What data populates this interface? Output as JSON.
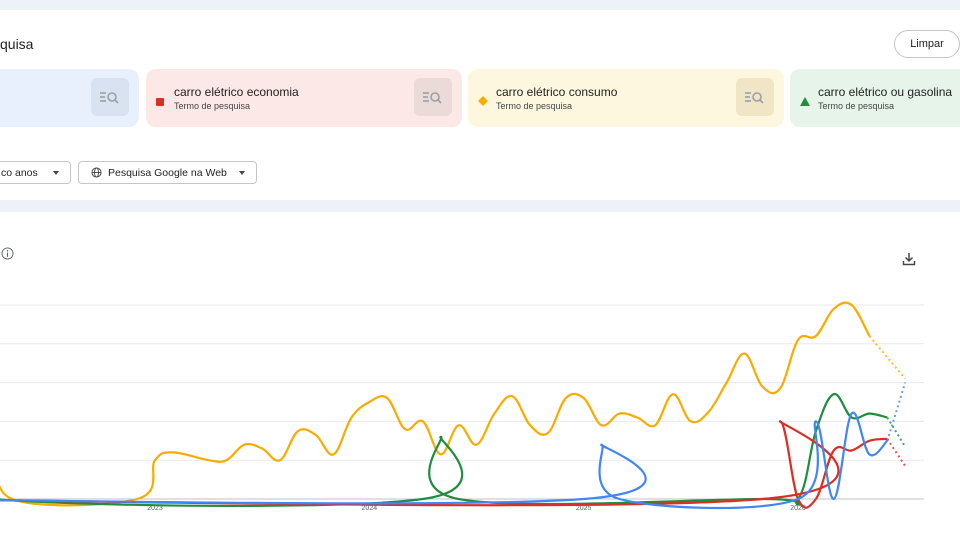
{
  "header": {
    "title": "quisa",
    "clear_label": "Limpar"
  },
  "terms": [
    {
      "label": "",
      "sub": "",
      "color": "#4285f4",
      "bg": "#e8f0fe"
    },
    {
      "label": "carro elétrico economia",
      "sub": "Termo de pesquisa",
      "color": "#d93025",
      "bg": "#fce8e6",
      "shape": "square"
    },
    {
      "label": "carro elétrico consumo",
      "sub": "Termo de pesquisa",
      "color": "#f9ab00",
      "bg": "#fef7e0",
      "shape": "diamond"
    },
    {
      "label": "carro elétrico ou gasolina",
      "sub": "Termo de pesquisa",
      "color": "#1e8e3e",
      "bg": "#e6f4ea",
      "shape": "triangle"
    }
  ],
  "filters": {
    "period": "co anos",
    "source": "Pesquisa Google na Web"
  },
  "icons": {
    "search_term": "search-term-icon",
    "info": "info-icon",
    "download": "download-icon",
    "globe": "globe-icon",
    "dropdown": "chevron-down-icon"
  },
  "chart_data": {
    "type": "line",
    "x_ticks": [
      "2023",
      "2024",
      "2025",
      "2026"
    ],
    "x_range": [
      "2021-09",
      "2026-07"
    ],
    "y_range": [
      0,
      100
    ],
    "grid": true,
    "legend": "none",
    "series": [
      {
        "name": "carro elétrico consumo",
        "color": "#f9ab00",
        "points": [
          [
            "2021-09",
            40
          ],
          [
            "2021-11",
            40
          ],
          [
            "2022-01",
            38
          ],
          [
            "2022-02",
            35
          ],
          [
            "2022-03",
            0
          ],
          [
            "2022-04",
            28
          ],
          [
            "2022-05",
            0
          ],
          [
            "2022-12",
            0
          ],
          [
            "2023-01",
            20
          ],
          [
            "2023-02",
            24
          ],
          [
            "2023-04",
            20
          ],
          [
            "2023-05",
            20
          ],
          [
            "2023-06",
            28
          ],
          [
            "2023-07",
            26
          ],
          [
            "2023-08",
            20
          ],
          [
            "2023-09",
            35
          ],
          [
            "2023-10",
            33
          ],
          [
            "2023-11",
            23
          ],
          [
            "2023-12",
            42
          ],
          [
            "2024-01",
            50
          ],
          [
            "2024-02",
            52
          ],
          [
            "2024-03",
            36
          ],
          [
            "2024-04",
            40
          ],
          [
            "2024-05",
            23
          ],
          [
            "2024-06",
            38
          ],
          [
            "2024-07",
            28
          ],
          [
            "2024-08",
            44
          ],
          [
            "2024-09",
            53
          ],
          [
            "2024-10",
            38
          ],
          [
            "2024-11",
            34
          ],
          [
            "2024-12",
            52
          ],
          [
            "2025-01",
            52
          ],
          [
            "2025-02",
            38
          ],
          [
            "2025-03",
            44
          ],
          [
            "2025-04",
            42
          ],
          [
            "2025-05",
            38
          ],
          [
            "2025-06",
            54
          ],
          [
            "2025-07",
            40
          ],
          [
            "2025-08",
            45
          ],
          [
            "2025-09",
            60
          ],
          [
            "2025-10",
            75
          ],
          [
            "2025-11",
            58
          ],
          [
            "2025-12",
            57
          ],
          [
            "2026-01",
            82
          ],
          [
            "2026-02",
            84
          ],
          [
            "2026-03",
            98
          ],
          [
            "2026-04",
            100
          ],
          [
            "2026-05",
            84
          ]
        ],
        "projected": [
          [
            "2026-05",
            84
          ],
          [
            "2026-07",
            62
          ]
        ]
      },
      {
        "name": "carro elétrico ou gasolina",
        "color": "#1e8e3e",
        "points": [
          [
            "2021-09",
            0
          ],
          [
            "2022-02",
            0
          ],
          [
            "2022-03",
            20
          ],
          [
            "2022-04",
            0
          ],
          [
            "2024-04",
            0
          ],
          [
            "2024-05",
            32
          ],
          [
            "2024-06",
            0
          ],
          [
            "2025-11",
            0
          ],
          [
            "2026-01",
            0
          ],
          [
            "2026-02",
            35
          ],
          [
            "2026-03",
            54
          ],
          [
            "2026-04",
            42
          ],
          [
            "2026-05",
            44
          ],
          [
            "2026-06",
            42
          ]
        ],
        "projected": [
          [
            "2026-06",
            42
          ],
          [
            "2026-07",
            27
          ]
        ]
      },
      {
        "name": "carro elétrico economia",
        "color": "#d93025",
        "points": [
          [
            "2021-09",
            0
          ],
          [
            "2025-11",
            0
          ],
          [
            "2025-12",
            40
          ],
          [
            "2026-01",
            0
          ],
          [
            "2026-02",
            0
          ],
          [
            "2026-03",
            25
          ],
          [
            "2026-04",
            25
          ],
          [
            "2026-05",
            30
          ],
          [
            "2026-06",
            31
          ]
        ],
        "projected": [
          [
            "2026-06",
            31
          ],
          [
            "2026-07",
            17
          ]
        ]
      },
      {
        "name": "",
        "color": "#4285f4",
        "points": [
          [
            "2021-09",
            0
          ],
          [
            "2025-01",
            0
          ],
          [
            "2025-02",
            28
          ],
          [
            "2025-03",
            0
          ],
          [
            "2026-01",
            0
          ],
          [
            "2026-02",
            40
          ],
          [
            "2026-03",
            0
          ],
          [
            "2026-04",
            44
          ],
          [
            "2026-05",
            23
          ],
          [
            "2026-06",
            30
          ]
        ],
        "projected": [
          [
            "2026-06",
            30
          ],
          [
            "2026-07",
            60
          ]
        ]
      }
    ]
  }
}
